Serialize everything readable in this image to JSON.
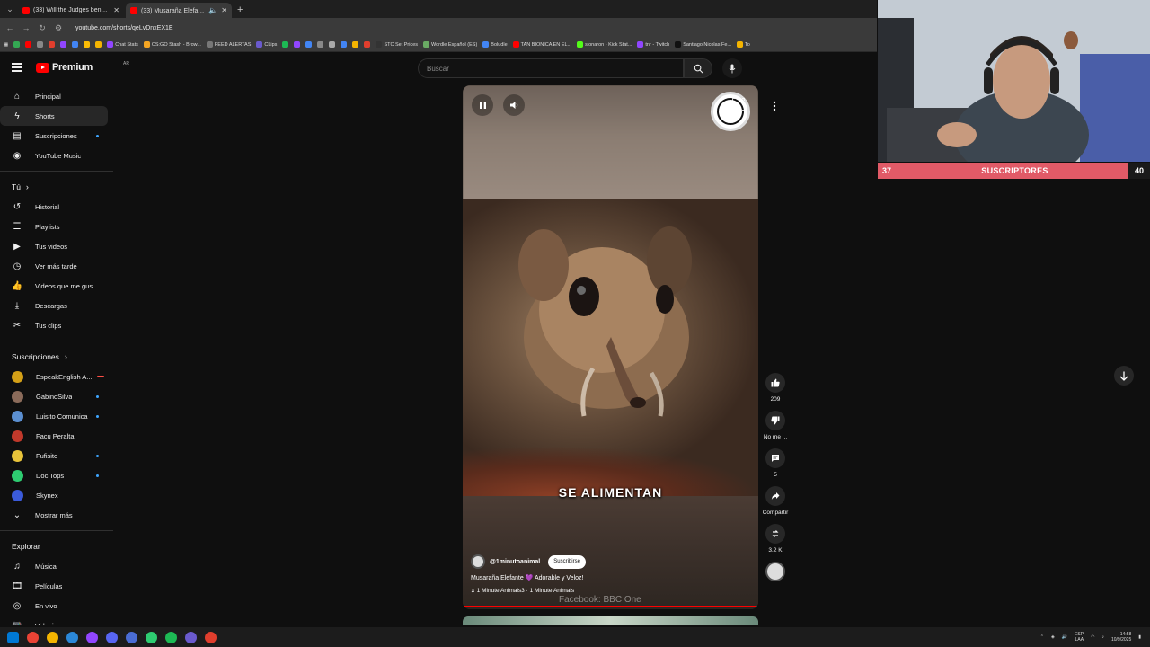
{
  "browser": {
    "tabs": [
      {
        "title": "(33) Will the Judges bend over",
        "active": false
      },
      {
        "title": "(33) Musaraña Elefante 💜",
        "active": true
      }
    ],
    "url": "youtube.com/shorts/qeLvDnxEX1E",
    "bookmarks": [
      {
        "label": "",
        "color": "#34a853"
      },
      {
        "label": "",
        "color": "#ff0000"
      },
      {
        "label": "",
        "color": "#888888"
      },
      {
        "label": "",
        "color": "#e03e2d"
      },
      {
        "label": "",
        "color": "#9146ff"
      },
      {
        "label": "",
        "color": "#4285f4"
      },
      {
        "label": "",
        "color": "#fbbc05"
      },
      {
        "label": "",
        "color": "#f4b400"
      },
      {
        "label": "Chat Stats",
        "color": "#9146ff"
      },
      {
        "label": "CS:GO Stash - Brow...",
        "color": "#f5a623"
      },
      {
        "label": "FEED ALERTAS",
        "color": "#777777"
      },
      {
        "label": "CLips",
        "color": "#6a5acd"
      },
      {
        "label": "",
        "color": "#1db954"
      },
      {
        "label": "",
        "color": "#9146ff"
      },
      {
        "label": "",
        "color": "#4285f4"
      },
      {
        "label": "",
        "color": "#888888"
      },
      {
        "label": "",
        "color": "#aaaaaa"
      },
      {
        "label": "",
        "color": "#4285f4"
      },
      {
        "label": "",
        "color": "#f4b400"
      },
      {
        "label": "",
        "color": "#e03e2d"
      },
      {
        "label": "STC Set Prices",
        "color": "#333333"
      },
      {
        "label": "Wordle Español (ES)",
        "color": "#6aaa64"
      },
      {
        "label": "Boludle",
        "color": "#4285f4"
      },
      {
        "label": "TAN BIONICA EN EL...",
        "color": "#ff0000"
      },
      {
        "label": "sionaron - Kick Stat...",
        "color": "#53fc18"
      },
      {
        "label": "tnr - Twitch",
        "color": "#9146ff"
      },
      {
        "label": "Santiago Nicolas Fe...",
        "color": "#111111"
      },
      {
        "label": "To",
        "color": "#f4b400"
      }
    ]
  },
  "header": {
    "logo_text": "Premium",
    "logo_sup": "AR",
    "search_placeholder": "Buscar"
  },
  "sidebar": {
    "main": [
      {
        "label": "Principal",
        "icon": "home-icon",
        "active": false
      },
      {
        "label": "Shorts",
        "icon": "shorts-icon",
        "active": true
      },
      {
        "label": "Suscripciones",
        "icon": "subscriptions-icon",
        "active": false,
        "dot": true
      },
      {
        "label": "YouTube Music",
        "icon": "music-icon",
        "active": false
      }
    ],
    "you_heading": "Tú",
    "you": [
      {
        "label": "Historial",
        "icon": "history-icon"
      },
      {
        "label": "Playlists",
        "icon": "playlists-icon"
      },
      {
        "label": "Tus videos",
        "icon": "your-videos-icon"
      },
      {
        "label": "Ver más tarde",
        "icon": "watch-later-icon"
      },
      {
        "label": "Videos que me gus...",
        "icon": "liked-icon"
      },
      {
        "label": "Descargas",
        "icon": "download-icon"
      },
      {
        "label": "Tus clips",
        "icon": "clips-icon"
      }
    ],
    "subs_heading": "Suscripciones",
    "subs": [
      {
        "label": "EspeakEnglish A...",
        "color": "#d4a017",
        "live": true
      },
      {
        "label": "GabinoSilva",
        "color": "#8b6b5a",
        "dot": true
      },
      {
        "label": "Luisito Comunica",
        "color": "#5b8fd1",
        "dot": true
      },
      {
        "label": "Facu Peralta",
        "color": "#c0392b"
      },
      {
        "label": "Fufisito",
        "color": "#e8c33a",
        "dot": true
      },
      {
        "label": "Doc Tops",
        "color": "#2ecc71",
        "dot": true
      },
      {
        "label": "Skynex",
        "color": "#3b5bdb"
      }
    ],
    "show_more": "Mostrar más",
    "explore_heading": "Explorar",
    "explore": [
      {
        "label": "Música",
        "icon": "music-note-icon"
      },
      {
        "label": "Películas",
        "icon": "film-icon"
      },
      {
        "label": "En vivo",
        "icon": "live-icon"
      },
      {
        "label": "Videojuegos",
        "icon": "gaming-icon"
      }
    ]
  },
  "short": {
    "caption": "SE ALIMENTAN",
    "channel": "@1minutoanimal",
    "subscribe": "Suscribirse",
    "title": "Musaraña Elefante 💜 Adorable y Veloz!",
    "music": "♫ 1 Minute Animals3 · 1 Minute Animals",
    "watermark": "Facebook: BBC One",
    "progress": 0.99
  },
  "actions": {
    "likes": "209",
    "dislike": "No me ...",
    "comments": "5",
    "share": "Compartir",
    "remix": "3.2 K"
  },
  "stream_overlay": {
    "current": "37",
    "label": "SUSCRIPTORES",
    "goal": "40"
  },
  "taskbar": {
    "lang": "ESP",
    "lang2": "LAA",
    "time": "14:58",
    "date": "10/9/2025",
    "apps": [
      "#0078d4",
      "#ea4335",
      "#f4b400",
      "#2b88d8",
      "#9146ff",
      "#5865f2",
      "#4a6cd4",
      "#2ecc71",
      "#1db954",
      "#6a5acd",
      "#e03e2d"
    ]
  }
}
